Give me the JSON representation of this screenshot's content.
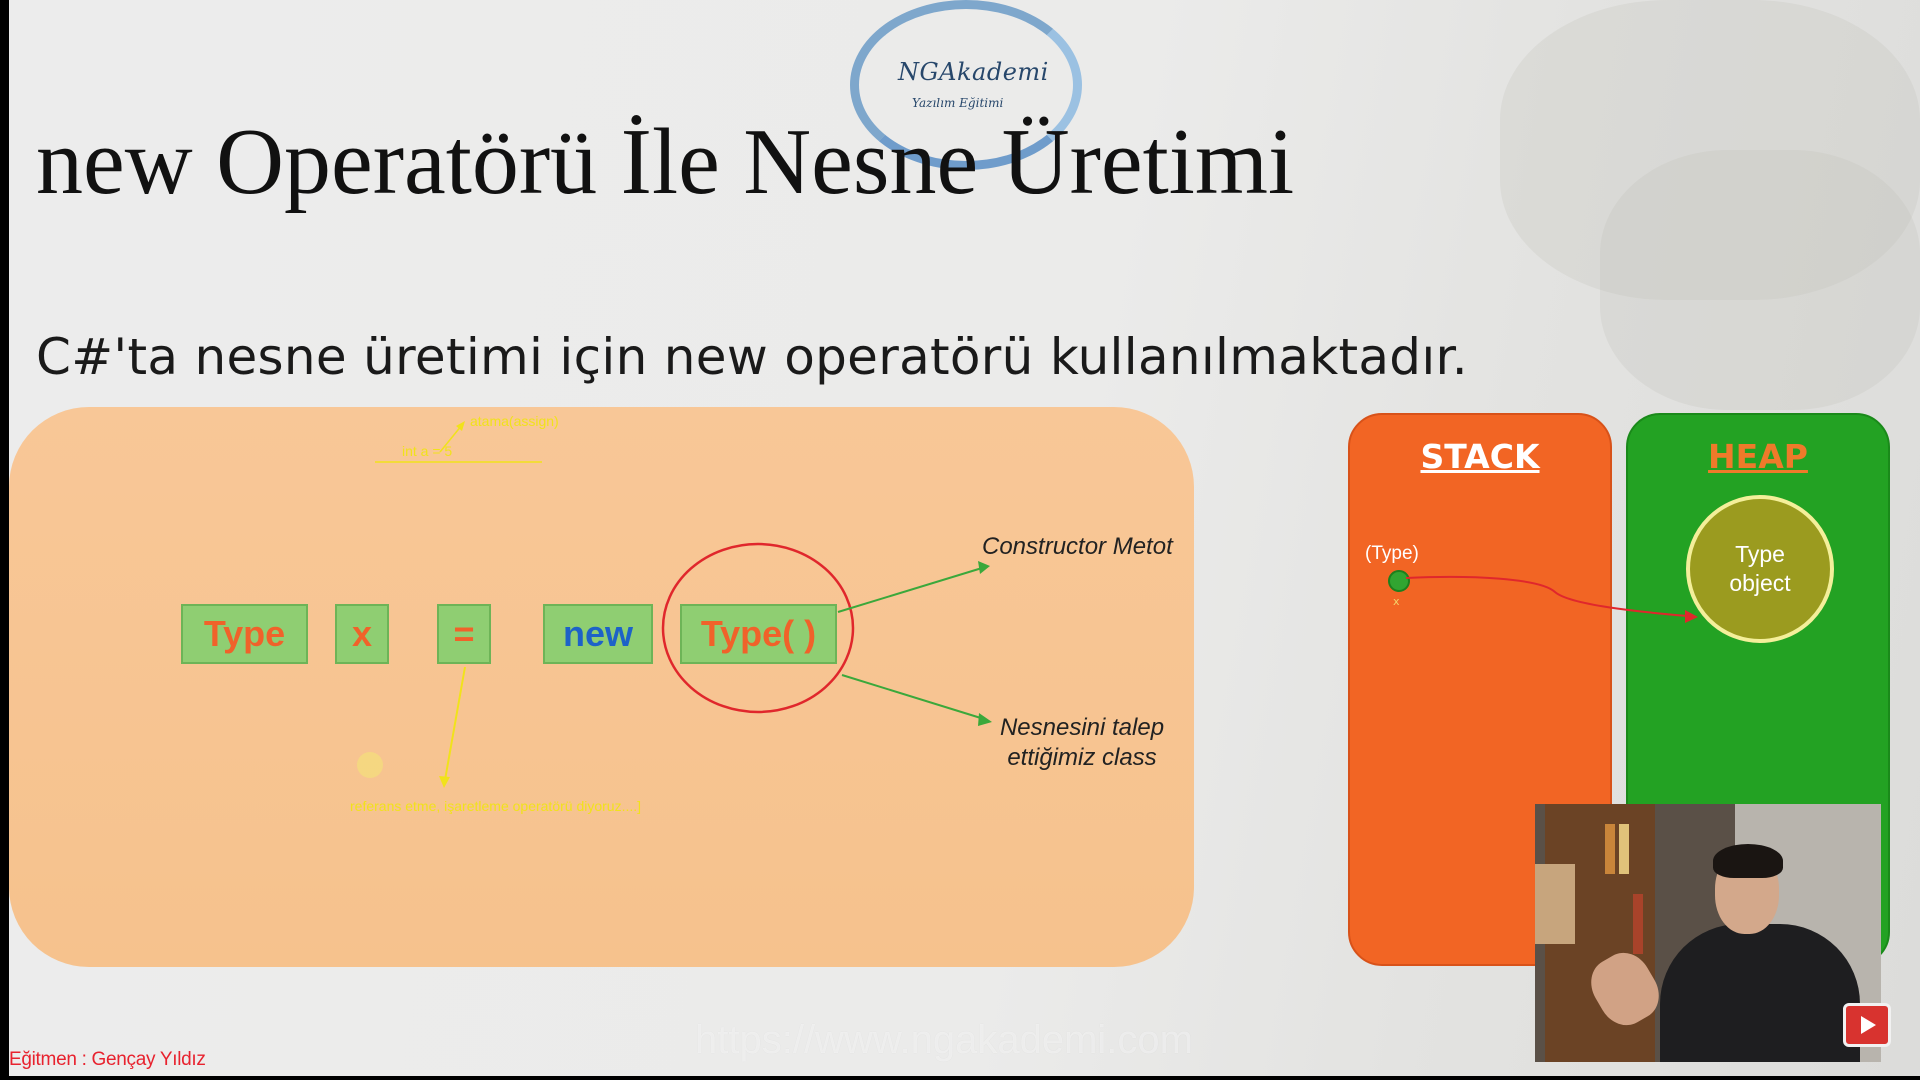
{
  "logo": {
    "name": "NGAkademi",
    "tagline": "Yazılım Eğitimi"
  },
  "slide": {
    "title": "new Operatörü İle Nesne Üretimi",
    "subtitle": "C#'ta nesne üretimi için new operatörü kullanılmaktadır."
  },
  "diagram": {
    "tokens": [
      "Type",
      "x",
      "=",
      "new",
      "Type( )"
    ],
    "constructor_label": "Constructor Metot",
    "class_label_line1": "Nesnesini talep",
    "class_label_line2": "ettiğimiz class",
    "annotation_assign": "atama(assign)",
    "annotation_int": "int a = 5",
    "annotation_reference": "referans etme, işaretleme operatörü diyoruz....]"
  },
  "memory": {
    "stack_title": "STACK",
    "heap_title": "HEAP",
    "reference_type": "(Type)",
    "reference_var": "x",
    "object_line1": "Type",
    "object_line2": "object"
  },
  "footer": {
    "watermark": "https://www.ngakademi.com",
    "instructor": "Eğitmen : Gençay Yıldız"
  },
  "colors": {
    "panel": "#f6c28d",
    "token_bg": "#8fce72",
    "token_orange": "#f0622a",
    "token_blue": "#1d62c8",
    "stack": "#f26524",
    "heap": "#23a223",
    "annotation_yellow": "#f1e21b",
    "instructor_red": "#e8222e"
  },
  "icons": {
    "play": "youtube-play-icon"
  }
}
